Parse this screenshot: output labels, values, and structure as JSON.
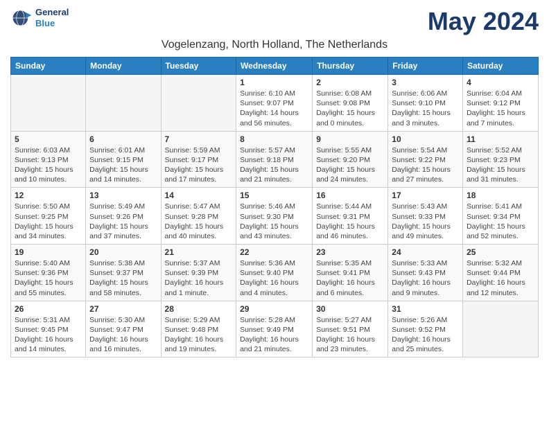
{
  "logo": {
    "line1": "General",
    "line2": "Blue"
  },
  "title": "May 2024",
  "subtitle": "Vogelenzang, North Holland, The Netherlands",
  "weekdays": [
    "Sunday",
    "Monday",
    "Tuesday",
    "Wednesday",
    "Thursday",
    "Friday",
    "Saturday"
  ],
  "weeks": [
    [
      {
        "day": "",
        "info": ""
      },
      {
        "day": "",
        "info": ""
      },
      {
        "day": "",
        "info": ""
      },
      {
        "day": "1",
        "info": "Sunrise: 6:10 AM\nSunset: 9:07 PM\nDaylight: 14 hours\nand 56 minutes."
      },
      {
        "day": "2",
        "info": "Sunrise: 6:08 AM\nSunset: 9:08 PM\nDaylight: 15 hours\nand 0 minutes."
      },
      {
        "day": "3",
        "info": "Sunrise: 6:06 AM\nSunset: 9:10 PM\nDaylight: 15 hours\nand 3 minutes."
      },
      {
        "day": "4",
        "info": "Sunrise: 6:04 AM\nSunset: 9:12 PM\nDaylight: 15 hours\nand 7 minutes."
      }
    ],
    [
      {
        "day": "5",
        "info": "Sunrise: 6:03 AM\nSunset: 9:13 PM\nDaylight: 15 hours\nand 10 minutes."
      },
      {
        "day": "6",
        "info": "Sunrise: 6:01 AM\nSunset: 9:15 PM\nDaylight: 15 hours\nand 14 minutes."
      },
      {
        "day": "7",
        "info": "Sunrise: 5:59 AM\nSunset: 9:17 PM\nDaylight: 15 hours\nand 17 minutes."
      },
      {
        "day": "8",
        "info": "Sunrise: 5:57 AM\nSunset: 9:18 PM\nDaylight: 15 hours\nand 21 minutes."
      },
      {
        "day": "9",
        "info": "Sunrise: 5:55 AM\nSunset: 9:20 PM\nDaylight: 15 hours\nand 24 minutes."
      },
      {
        "day": "10",
        "info": "Sunrise: 5:54 AM\nSunset: 9:22 PM\nDaylight: 15 hours\nand 27 minutes."
      },
      {
        "day": "11",
        "info": "Sunrise: 5:52 AM\nSunset: 9:23 PM\nDaylight: 15 hours\nand 31 minutes."
      }
    ],
    [
      {
        "day": "12",
        "info": "Sunrise: 5:50 AM\nSunset: 9:25 PM\nDaylight: 15 hours\nand 34 minutes."
      },
      {
        "day": "13",
        "info": "Sunrise: 5:49 AM\nSunset: 9:26 PM\nDaylight: 15 hours\nand 37 minutes."
      },
      {
        "day": "14",
        "info": "Sunrise: 5:47 AM\nSunset: 9:28 PM\nDaylight: 15 hours\nand 40 minutes."
      },
      {
        "day": "15",
        "info": "Sunrise: 5:46 AM\nSunset: 9:30 PM\nDaylight: 15 hours\nand 43 minutes."
      },
      {
        "day": "16",
        "info": "Sunrise: 5:44 AM\nSunset: 9:31 PM\nDaylight: 15 hours\nand 46 minutes."
      },
      {
        "day": "17",
        "info": "Sunrise: 5:43 AM\nSunset: 9:33 PM\nDaylight: 15 hours\nand 49 minutes."
      },
      {
        "day": "18",
        "info": "Sunrise: 5:41 AM\nSunset: 9:34 PM\nDaylight: 15 hours\nand 52 minutes."
      }
    ],
    [
      {
        "day": "19",
        "info": "Sunrise: 5:40 AM\nSunset: 9:36 PM\nDaylight: 15 hours\nand 55 minutes."
      },
      {
        "day": "20",
        "info": "Sunrise: 5:38 AM\nSunset: 9:37 PM\nDaylight: 15 hours\nand 58 minutes."
      },
      {
        "day": "21",
        "info": "Sunrise: 5:37 AM\nSunset: 9:39 PM\nDaylight: 16 hours\nand 1 minute."
      },
      {
        "day": "22",
        "info": "Sunrise: 5:36 AM\nSunset: 9:40 PM\nDaylight: 16 hours\nand 4 minutes."
      },
      {
        "day": "23",
        "info": "Sunrise: 5:35 AM\nSunset: 9:41 PM\nDaylight: 16 hours\nand 6 minutes."
      },
      {
        "day": "24",
        "info": "Sunrise: 5:33 AM\nSunset: 9:43 PM\nDaylight: 16 hours\nand 9 minutes."
      },
      {
        "day": "25",
        "info": "Sunrise: 5:32 AM\nSunset: 9:44 PM\nDaylight: 16 hours\nand 12 minutes."
      }
    ],
    [
      {
        "day": "26",
        "info": "Sunrise: 5:31 AM\nSunset: 9:45 PM\nDaylight: 16 hours\nand 14 minutes."
      },
      {
        "day": "27",
        "info": "Sunrise: 5:30 AM\nSunset: 9:47 PM\nDaylight: 16 hours\nand 16 minutes."
      },
      {
        "day": "28",
        "info": "Sunrise: 5:29 AM\nSunset: 9:48 PM\nDaylight: 16 hours\nand 19 minutes."
      },
      {
        "day": "29",
        "info": "Sunrise: 5:28 AM\nSunset: 9:49 PM\nDaylight: 16 hours\nand 21 minutes."
      },
      {
        "day": "30",
        "info": "Sunrise: 5:27 AM\nSunset: 9:51 PM\nDaylight: 16 hours\nand 23 minutes."
      },
      {
        "day": "31",
        "info": "Sunrise: 5:26 AM\nSunset: 9:52 PM\nDaylight: 16 hours\nand 25 minutes."
      },
      {
        "day": "",
        "info": ""
      }
    ]
  ]
}
